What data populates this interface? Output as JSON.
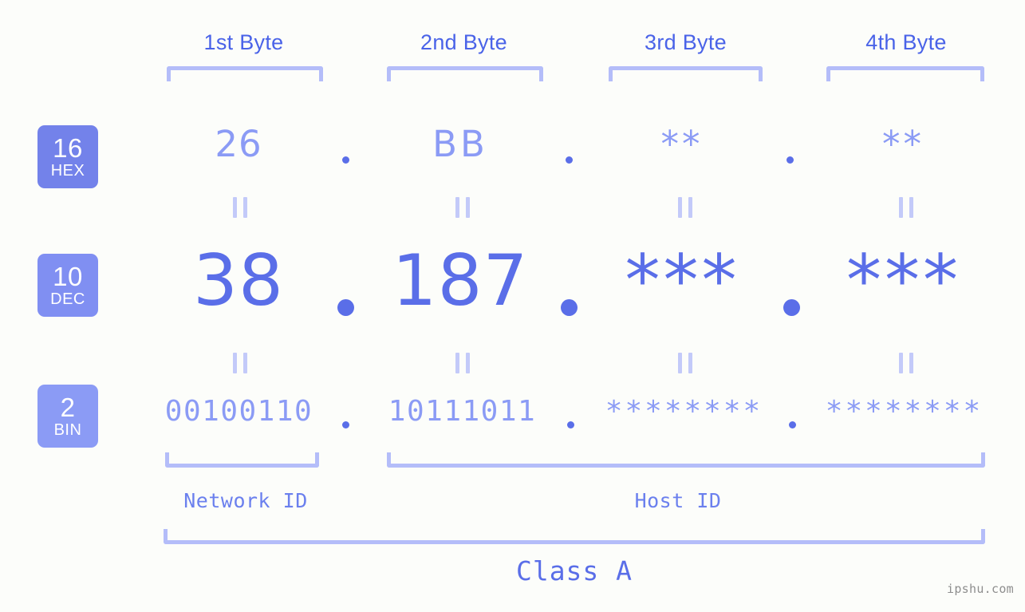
{
  "page": {
    "background_color": "#fcfdfa",
    "accent_color": "#5a6ee8",
    "light_accent_color": "#8b9bf5",
    "bracket_color": "#b4bdf9",
    "watermark": "ipshu.com"
  },
  "byte_headers": [
    {
      "label": "1st Byte"
    },
    {
      "label": "2nd Byte"
    },
    {
      "label": "3rd Byte"
    },
    {
      "label": "4th Byte"
    }
  ],
  "radix_badges": [
    {
      "number": "16",
      "label": "HEX",
      "color": "#7382ea"
    },
    {
      "number": "10",
      "label": "DEC",
      "color": "#808ff2"
    },
    {
      "number": "2",
      "label": "BIN",
      "color": "#8b9bf5"
    }
  ],
  "rows": {
    "hex": {
      "radix": "16",
      "radix_label": "HEX",
      "values": [
        "26",
        "BB",
        "**",
        "**"
      ]
    },
    "dec": {
      "radix": "10",
      "radix_label": "DEC",
      "values": [
        "38",
        "187",
        "***",
        "***"
      ]
    },
    "bin": {
      "radix": "2",
      "radix_label": "BIN",
      "values": [
        "00100110",
        "10111011",
        "********",
        "********"
      ]
    }
  },
  "separators": {
    "hex": [
      ".",
      ".",
      "."
    ],
    "dec": [
      ".",
      ".",
      "."
    ],
    "bin": [
      ".",
      ".",
      "."
    ]
  },
  "equality_marks": {
    "symbol": "=",
    "count_per_row": 4
  },
  "id_sections": [
    {
      "label": "Network ID",
      "span": "1st Byte"
    },
    {
      "label": "Host ID",
      "span": "2nd-4th Byte"
    }
  ],
  "address_class": {
    "label": "Class A"
  }
}
